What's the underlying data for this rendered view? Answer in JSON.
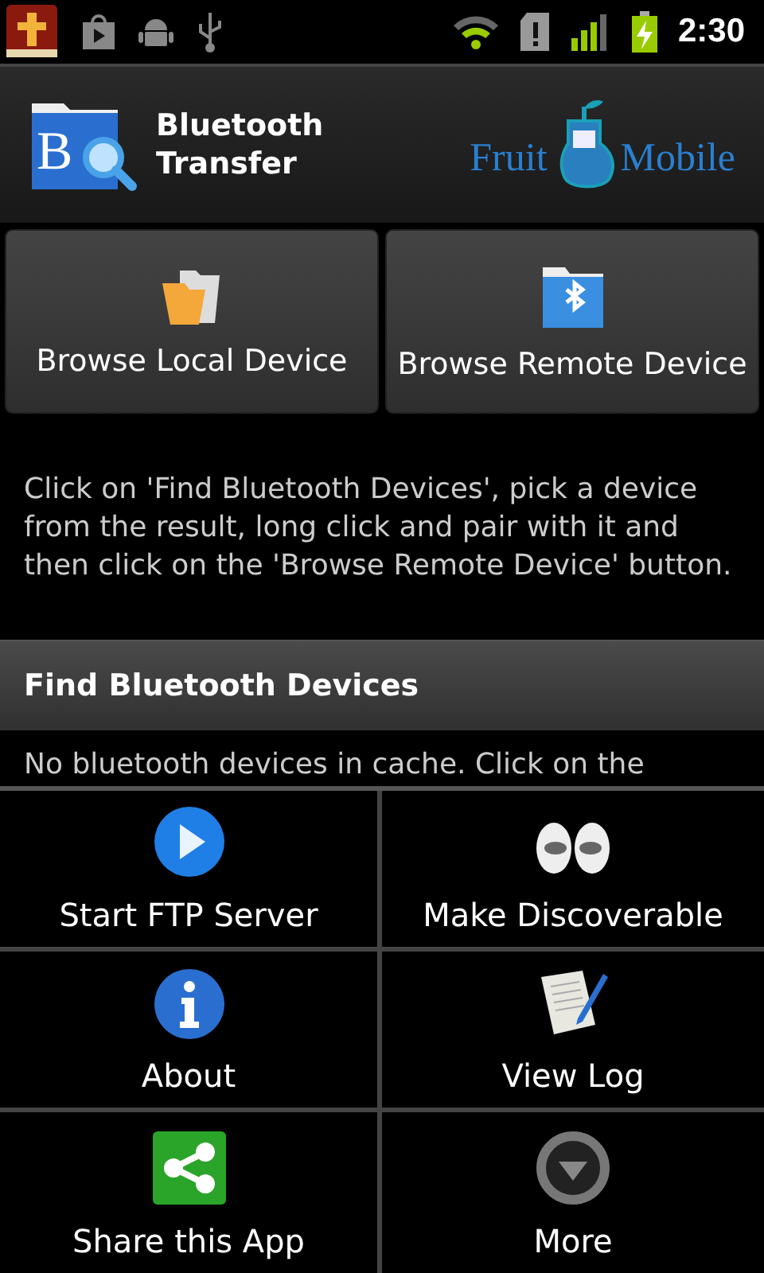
{
  "status_bar": {
    "time": "2:30"
  },
  "header": {
    "icon_letter": "B",
    "title": "Bluetooth Transfer",
    "logo_left": "Fruit",
    "logo_right": "Mobile"
  },
  "buttons": [
    {
      "label": "Browse Local Device",
      "kind": "local"
    },
    {
      "label": "Browse Remote Device",
      "kind": "remote"
    }
  ],
  "instructions": "Click on 'Find Bluetooth Devices', pick a device from the result, long click and pair with it and then click on the 'Browse Remote Device' button.",
  "section": {
    "title": "Find Bluetooth Devices",
    "message": "No bluetooth devices in cache. Click on the"
  },
  "menu": [
    {
      "label": "Start FTP Server",
      "kind": "play"
    },
    {
      "label": "Make Discoverable",
      "kind": "eyes"
    },
    {
      "label": "About",
      "kind": "info"
    },
    {
      "label": "View Log",
      "kind": "log"
    },
    {
      "label": "Share this App",
      "kind": "share"
    },
    {
      "label": "More",
      "kind": "more"
    }
  ]
}
